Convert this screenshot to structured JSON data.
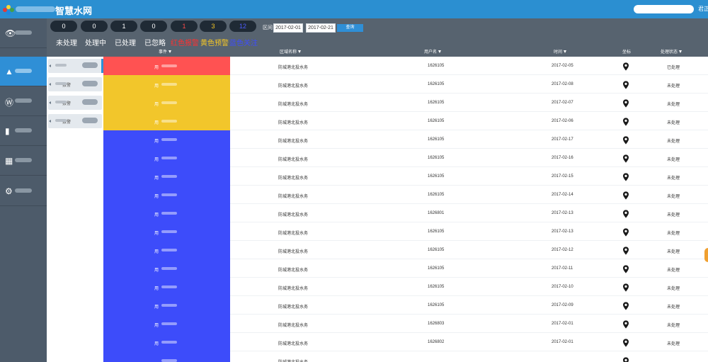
{
  "header": {
    "brand": "智慧水网",
    "user": "君正",
    "logo_colors": [
      "#e53935",
      "#fdd835",
      "#43a047",
      "#1e88e5"
    ]
  },
  "nav": {
    "items": [
      {
        "icon": "eye-icon",
        "glyph": "👁",
        "active": false
      },
      {
        "icon": "warning-icon",
        "glyph": "▲",
        "active": true
      },
      {
        "icon": "wordpress-icon",
        "glyph": "Ⓦ",
        "active": false
      },
      {
        "icon": "bar-chart-icon",
        "glyph": "▮",
        "active": false
      },
      {
        "icon": "table-icon",
        "glyph": "▦",
        "active": false
      },
      {
        "icon": "gear-icon",
        "glyph": "⚙",
        "active": false
      }
    ]
  },
  "summary": {
    "counts": [
      {
        "value": "0",
        "label": "未处理",
        "tone": "white"
      },
      {
        "value": "0",
        "label": "处理中",
        "tone": "white"
      },
      {
        "value": "1",
        "label": "已处理",
        "tone": "white"
      },
      {
        "value": "0",
        "label": "已忽略",
        "tone": "white"
      },
      {
        "value": "1",
        "label": "红色报警",
        "tone": "red"
      },
      {
        "value": "3",
        "label": "黄色预警",
        "tone": "yellow"
      },
      {
        "value": "12",
        "label": "蓝色关注",
        "tone": "blue"
      }
    ],
    "range_label": "区间",
    "date_from": "2017-02-01",
    "date_to": "2017-02-21",
    "query_label": "查询"
  },
  "table": {
    "columns": [
      "事件",
      "区域名称",
      "用户名",
      "时间",
      "坐标",
      "处理状态"
    ],
    "types": [
      {
        "name": "",
        "count": "",
        "active": true
      },
      {
        "name": "报警",
        "count": "",
        "active": false
      },
      {
        "name": "报警",
        "count": "",
        "active": false
      },
      {
        "name": "报警",
        "count": "",
        "active": false
      }
    ],
    "colors": {
      "red": "#ff5252",
      "yellow": "#f2c62b",
      "blue": "#3d4cfa"
    },
    "rows": [
      {
        "color": "red",
        "event": "用",
        "area": "防城港北投水务",
        "user": "1626105",
        "time": "2017-02-05",
        "status": "已处理"
      },
      {
        "color": "yellow",
        "event": "用",
        "area": "防城港北投水务",
        "user": "1626105",
        "time": "2017-02-08",
        "status": "未处理"
      },
      {
        "color": "yellow",
        "event": "用",
        "area": "防城港北投水务",
        "user": "1626105",
        "time": "2017-02-07",
        "status": "未处理"
      },
      {
        "color": "yellow",
        "event": "用",
        "area": "防城港北投水务",
        "user": "1626105",
        "time": "2017-02-06",
        "status": "未处理"
      },
      {
        "color": "blue",
        "event": "用",
        "area": "防城港北投水务",
        "user": "1626105",
        "time": "2017-02-17",
        "status": "未处理"
      },
      {
        "color": "blue",
        "event": "用",
        "area": "防城港北投水务",
        "user": "1626105",
        "time": "2017-02-16",
        "status": "未处理"
      },
      {
        "color": "blue",
        "event": "用",
        "area": "防城港北投水务",
        "user": "1626105",
        "time": "2017-02-15",
        "status": "未处理"
      },
      {
        "color": "blue",
        "event": "用",
        "area": "防城港北投水务",
        "user": "1626105",
        "time": "2017-02-14",
        "status": "未处理"
      },
      {
        "color": "blue",
        "event": "用",
        "area": "防城港北投水务",
        "user": "1626801",
        "time": "2017-02-13",
        "status": "未处理"
      },
      {
        "color": "blue",
        "event": "用",
        "area": "防城港北投水务",
        "user": "1626105",
        "time": "2017-02-13",
        "status": "未处理"
      },
      {
        "color": "blue",
        "event": "用",
        "area": "防城港北投水务",
        "user": "1626105",
        "time": "2017-02-12",
        "status": "未处理"
      },
      {
        "color": "blue",
        "event": "用",
        "area": "防城港北投水务",
        "user": "1626105",
        "time": "2017-02-11",
        "status": "未处理"
      },
      {
        "color": "blue",
        "event": "用",
        "area": "防城港北投水务",
        "user": "1626105",
        "time": "2017-02-10",
        "status": "未处理"
      },
      {
        "color": "blue",
        "event": "用",
        "area": "防城港北投水务",
        "user": "1626105",
        "time": "2017-02-09",
        "status": "未处理"
      },
      {
        "color": "blue",
        "event": "用",
        "area": "防城港北投水务",
        "user": "1626803",
        "time": "2017-02-01",
        "status": "未处理"
      },
      {
        "color": "blue",
        "event": "用",
        "area": "防城港北投水务",
        "user": "1626802",
        "time": "2017-02-01",
        "status": "未处理"
      },
      {
        "color": "blue",
        "event": "",
        "area": "防城港北投水务",
        "user": "",
        "time": "",
        "status": ""
      }
    ]
  }
}
